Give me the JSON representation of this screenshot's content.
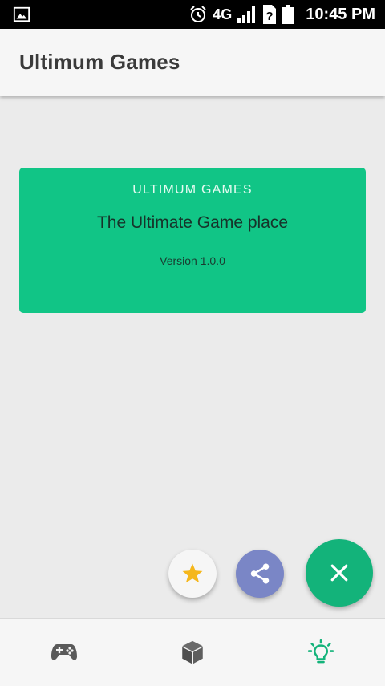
{
  "status_bar": {
    "network": "4G",
    "time": "10:45 PM",
    "icons": [
      "image-icon",
      "alarm-icon",
      "signal-icon",
      "sim-question-icon",
      "battery-icon"
    ]
  },
  "app_bar": {
    "title": "Ultimum Games"
  },
  "card": {
    "title": "ULTIMUM GAMES",
    "subtitle": "The Ultimate Game place",
    "version": "Version 1.0.0"
  },
  "fab_menu": [
    {
      "icon": "star-icon",
      "color": "#f5b71c"
    },
    {
      "icon": "share-icon",
      "color": "#7a86c6"
    },
    {
      "icon": "close-icon",
      "color": "#13b37a"
    }
  ],
  "bottom_nav": {
    "items": [
      {
        "icon": "gamepad-icon",
        "active": false
      },
      {
        "icon": "box-icon",
        "active": false
      },
      {
        "icon": "lightbulb-icon",
        "active": true
      }
    ],
    "active_color": "#13b37a",
    "inactive_color": "#5a5a5a"
  },
  "colors": {
    "card": "#11c586",
    "background": "#ebebeb"
  }
}
